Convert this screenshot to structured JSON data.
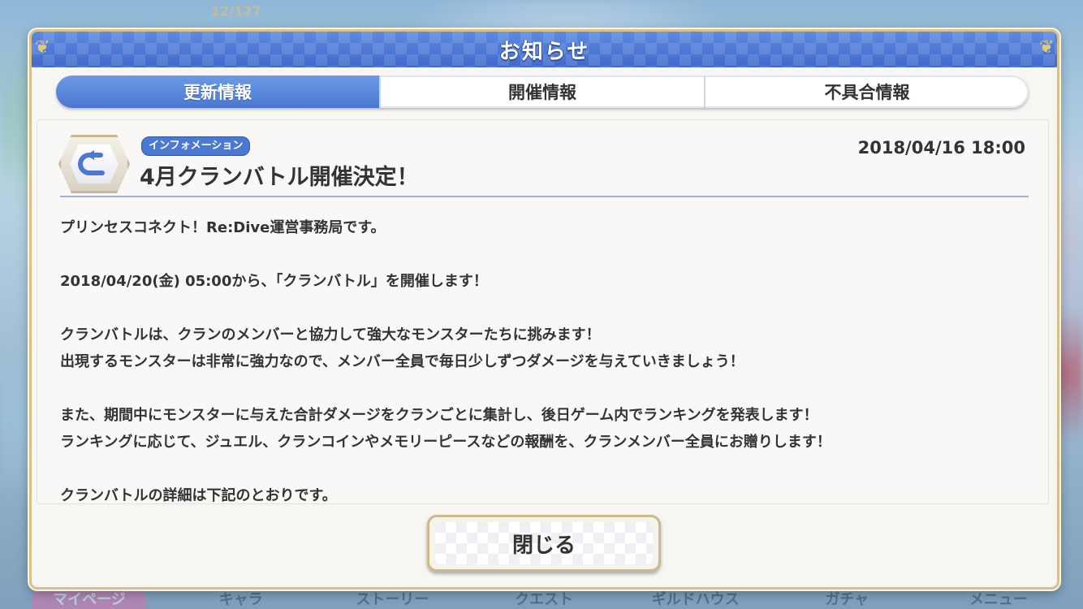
{
  "dialog": {
    "title": "お知らせ"
  },
  "tabs": [
    {
      "label": "更新情報",
      "active": true
    },
    {
      "label": "開催情報",
      "active": false
    },
    {
      "label": "不具合情報",
      "active": false
    }
  ],
  "article": {
    "category_badge": "インフォメーション",
    "title": "4月クランバトル開催決定！",
    "date": "2018/04/16 18:00",
    "paragraphs": [
      "プリンセスコネクト！Re:Dive運営事務局です。",
      "2018/04/20(金) 05:00から、「クランバトル」を開催します！",
      "クランバトルは、クランのメンバーと協力して強大なモンスターたちに挑みます！",
      "出現するモンスターは非常に強力なので、メンバー全員で毎日少しずつダメージを与えていきましょう！",
      "また、期間中にモンスターに与えた合計ダメージをクランごとに集計し、後日ゲーム内でランキングを発表します！",
      "ランキングに応じて、ジュエル、クランコインやメモリーピースなどの報酬を、クランメンバー全員にお贈りします！",
      "クランバトルの詳細は下記のとおりです。"
    ]
  },
  "buttons": {
    "close_label": "閉じる"
  },
  "background": {
    "hud_stamina": "12/127",
    "nav_items": [
      "マイページ",
      "キャラ",
      "ストーリー",
      "クエスト",
      "ギルドハウス",
      "ガチャ",
      "メニュー"
    ]
  },
  "colors": {
    "header_blue": "#4d78d6",
    "frame_gold": "#d7c08c",
    "badge_blue": "#4a78d2"
  }
}
